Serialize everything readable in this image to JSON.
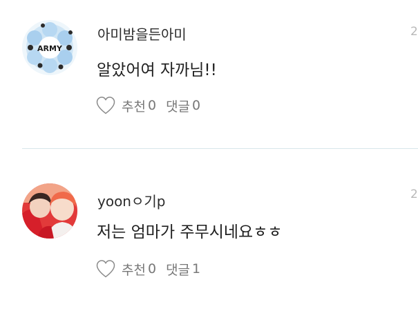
{
  "comments": [
    {
      "avatar_text": "ARMY",
      "username": "아미밤을든아미",
      "timestamp": "2",
      "text": "알았어여 자까님!!",
      "like_label": "추천",
      "like_count": "0",
      "reply_label": "댓글",
      "reply_count": "0"
    },
    {
      "username": "yoonㅇ기p",
      "timestamp": "2",
      "text": "저는 엄마가 주무시네요ㅎㅎ",
      "like_label": "추천",
      "like_count": "0",
      "reply_label": "댓글",
      "reply_count": "1"
    }
  ],
  "colors": {
    "divider": "#d7e6ea",
    "heart_stroke": "#8a8a8a",
    "meta_text": "#777777"
  }
}
